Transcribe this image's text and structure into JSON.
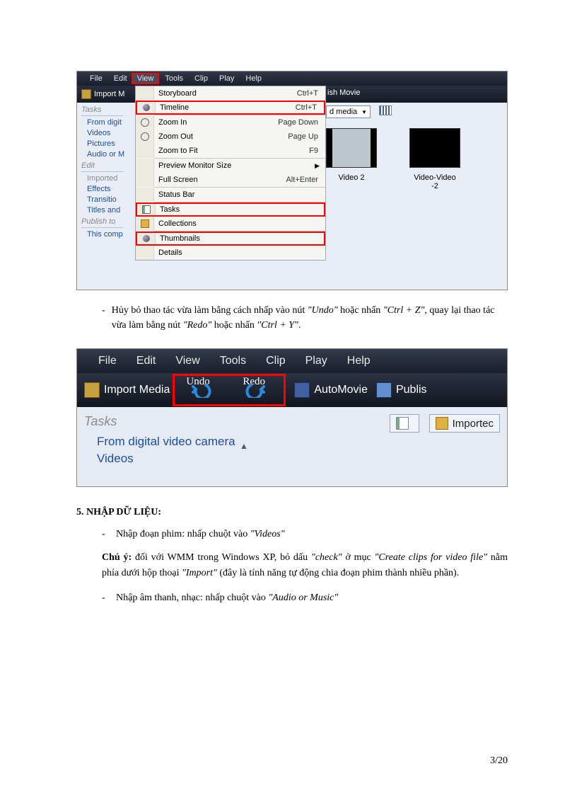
{
  "screenshot1": {
    "menubar": [
      "File",
      "Edit",
      "View",
      "Tools",
      "Clip",
      "Play",
      "Help"
    ],
    "active_menu_index": 2,
    "toolbar_import": "Import M",
    "toolbar_publish_fragment": "ish Movie",
    "dropdown": [
      {
        "label": "Storyboard",
        "shortcut": "Ctrl+T",
        "highlight": false,
        "icon": ""
      },
      {
        "label": "Timeline",
        "shortcut": "Ctrl+T",
        "highlight": true,
        "icon": "bullet"
      },
      {
        "sep": true
      },
      {
        "label": "Zoom In",
        "shortcut": "Page Down",
        "icon": "mag"
      },
      {
        "label": "Zoom Out",
        "shortcut": "Page Up",
        "icon": "mag"
      },
      {
        "label": "Zoom to Fit",
        "shortcut": "F9"
      },
      {
        "sep": true
      },
      {
        "label": "Preview Monitor Size",
        "shortcut": "",
        "arrow": true
      },
      {
        "label": "Full Screen",
        "shortcut": "Alt+Enter"
      },
      {
        "sep": true
      },
      {
        "label": "Status Bar"
      },
      {
        "sep": true
      },
      {
        "label": "Tasks",
        "highlight": true,
        "icon": "tasks"
      },
      {
        "label": "Collections",
        "icon": "coll"
      },
      {
        "sep": true
      },
      {
        "label": "Thumbnails",
        "highlight": true,
        "icon": "bullet"
      },
      {
        "label": "Details"
      }
    ],
    "leftpane": {
      "sections": [
        {
          "header": "Tasks",
          "items": [
            "From digit",
            "Videos",
            "Pictures",
            "Audio or M"
          ]
        },
        {
          "header": "Edit",
          "items": [
            "Imported",
            "Effects",
            "Transitio",
            "Titles and"
          ]
        },
        {
          "header": "Publish to",
          "items": [
            "This comp"
          ]
        }
      ]
    },
    "rightpane": {
      "combo_text": "d media",
      "thumbs": [
        {
          "caption": "Video 2",
          "dark": false
        },
        {
          "caption": "Video-Video -2",
          "dark": true
        }
      ]
    }
  },
  "para1": {
    "dash": "-",
    "pre1": "Hủy bỏ thao tác vừa làm bằng cách nhấp vào nút ",
    "undo": "\"Undo\"",
    "mid1": " hoặc nhấn ",
    "ctrlz": "\"Ctrl + Z\"",
    "mid2": ", quay lại thao tác vừa làm bằng nút ",
    "redo": "\"Redo\"",
    "mid3": " hoặc nhấn ",
    "ctrly": "\"Ctrl + Y\"",
    "end": "."
  },
  "screenshot2": {
    "menubar": [
      "File",
      "Edit",
      "View",
      "Tools",
      "Clip",
      "Play",
      "Help"
    ],
    "import_media": "Import Media",
    "undo_label": "Undo",
    "redo_label": "Redo",
    "automovie": "AutoMovie",
    "publish_fragment": "Publis",
    "tasks": "Tasks",
    "links": [
      "From digital video camera",
      "Videos"
    ],
    "imported_btn": "Importec"
  },
  "section5": {
    "heading": "5.  NHẬP DỮ LIỆU:",
    "bullet1_pre": "Nhập đoạn phim: nhấp chuột vào ",
    "bullet1_em": "\"Videos\"",
    "note_bold": "Chú ý:",
    "note_1": " đối với WMM trong Windows XP, bỏ dấu ",
    "note_em1": "\"check\"",
    "note_2": " ở mục ",
    "note_em2": "\"Create clips for video file\"",
    "note_3": " nằm phía dưới hộp thoại ",
    "note_em3": "\"Import\"",
    "note_4": " (đây là tính năng tự động chia đoạn phim thành nhiều phần).",
    "bullet2_pre": "Nhập âm thanh, nhạc: nhấp chuột vào ",
    "bullet2_em": "\"Audio or Music\""
  },
  "pagenum": "3/20"
}
